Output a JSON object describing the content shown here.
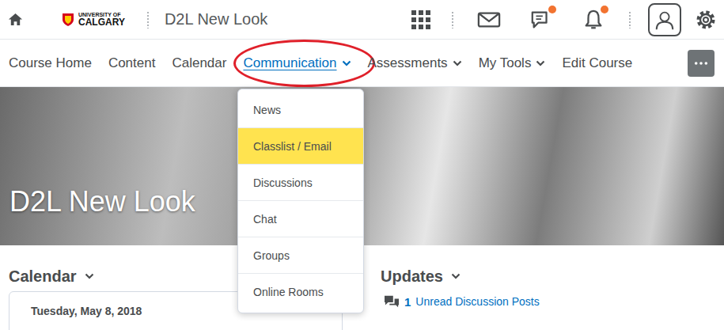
{
  "header": {
    "logo": [
      "UNIVERSITY OF",
      "CALGARY"
    ],
    "title": "D2L New Look",
    "notifications": [
      {
        "name": "messages",
        "unread": false
      },
      {
        "name": "discussions",
        "unread": true
      },
      {
        "name": "alerts",
        "unread": true
      }
    ]
  },
  "nav": [
    {
      "label": "Course Home",
      "dropdown": false,
      "selected": false,
      "circled": false
    },
    {
      "label": "Content",
      "dropdown": false,
      "selected": false,
      "circled": false
    },
    {
      "label": "Calendar",
      "dropdown": false,
      "selected": false,
      "circled": false
    },
    {
      "label": "Communication",
      "dropdown": true,
      "selected": true,
      "circled": true
    },
    {
      "label": "Assessments",
      "dropdown": true,
      "selected": false,
      "circled": false
    },
    {
      "label": "My Tools",
      "dropdown": true,
      "selected": false,
      "circled": false
    },
    {
      "label": "Edit Course",
      "dropdown": false,
      "selected": false,
      "circled": false
    }
  ],
  "menu": {
    "items": [
      {
        "label": "News",
        "selected": false
      },
      {
        "label": "Classlist / Email",
        "selected": true
      },
      {
        "label": "Discussions",
        "selected": false
      },
      {
        "label": "Chat",
        "selected": false
      },
      {
        "label": "Groups",
        "selected": false
      },
      {
        "label": "Online Rooms",
        "selected": false
      }
    ]
  },
  "hero": {
    "title": "D2L New Look"
  },
  "widgets": [
    {
      "title": "Calendar",
      "kind": "calendar",
      "date": "Tuesday, May 8, 2018"
    },
    {
      "title": "Updates",
      "kind": "updates",
      "count": "1",
      "text": "Unread Discussion Posts"
    }
  ]
}
